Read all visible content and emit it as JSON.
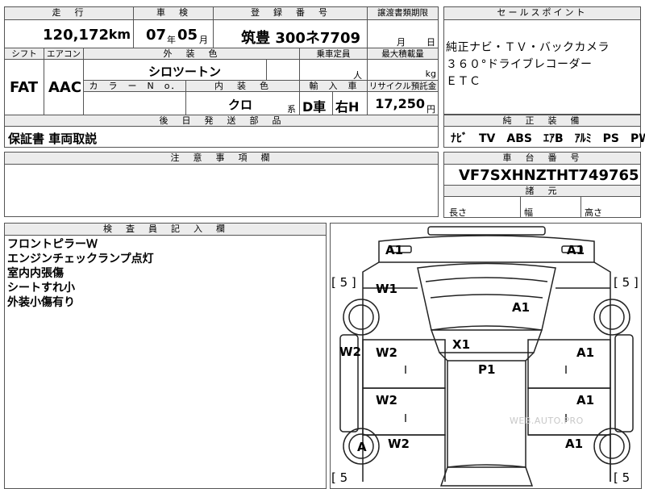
{
  "header": {
    "mileage_label": "走　行",
    "mileage_value": "120,172",
    "mileage_unit": "km",
    "inspection_label": "車　検",
    "inspection_year": "07",
    "inspection_year_unit": "年",
    "inspection_month": "05",
    "inspection_month_unit": "月",
    "registration_label": "登　録　番　号",
    "registration_value": "筑豊 300ネ7709",
    "transfer_label": "譲渡書類期限",
    "transfer_month_unit": "月",
    "transfer_day_unit": "日"
  },
  "selling_points": {
    "label": "セールスポイント",
    "lines": [
      "純正ナビ・ＴＶ・バックカメラ",
      "３６０°ドライブレコーダー",
      "ＥＴＣ"
    ]
  },
  "specs": {
    "shift_label": "シフト",
    "shift_value": "FAT",
    "ac_label": "エアコン",
    "ac_value": "AAC",
    "exterior_label": "外　装　色",
    "exterior_value": "シロツートン",
    "capacity_label": "乗車定員",
    "capacity_unit": "人",
    "load_label": "最大積載量",
    "load_unit": "kg",
    "color_no_label": "カ　ラ　ー　N　o．",
    "interior_label": "内　装　色",
    "interior_value": "クロ",
    "interior_unit": "系",
    "import_label": "輸　入　車",
    "import_value1": "D車",
    "import_value2": "右H",
    "recycle_label": "リサイクル預託金",
    "recycle_value": "17,250",
    "recycle_unit": "円"
  },
  "follow_up": {
    "label": "後　日　発　送　部　品",
    "value": "保証書 車両取説"
  },
  "equipment": {
    "label": "純　正　装　備",
    "value": "ﾅﾋﾞ　TV　ABS　ｴｱB　ｱﾙﾐ　PS　PW"
  },
  "caution": {
    "label": "注　意　事　項　欄"
  },
  "chassis": {
    "label": "車　台　番　号",
    "value": "VF7SXHNZTHT749765"
  },
  "dimensions": {
    "label": "諸　元",
    "length": "長さ",
    "width": "幅",
    "height": "高さ"
  },
  "inspector": {
    "label": "検　査　員　記　入　欄",
    "notes": [
      "フロントピラーＷ",
      "エンジンチェックランプ点灯",
      "室内内張傷",
      "シートすれ小",
      "外装小傷有り"
    ]
  },
  "diagram": {
    "marks": {
      "a1_front_left": "A1",
      "a1_front_right": "A1",
      "w1": "W1",
      "a1_hood": "A1",
      "bracket_top_left": "[ 5 ]",
      "bracket_top_right": "[ 5 ]",
      "w2_left_side": "W2",
      "w2_front_door": "W2",
      "x1": "X1",
      "a1_right_front_door": "A1",
      "p1": "P1",
      "w2_rear_door": "W2",
      "a1_right_rear_door": "A1",
      "a_wheel": "A",
      "w2_rear_fender": "W2",
      "a1_right_rear": "A1",
      "bracket_bottom_left": "[ 5",
      "bracket_bottom_right": "[ 5"
    },
    "watermark": "WEB.AUTO.PRO"
  }
}
